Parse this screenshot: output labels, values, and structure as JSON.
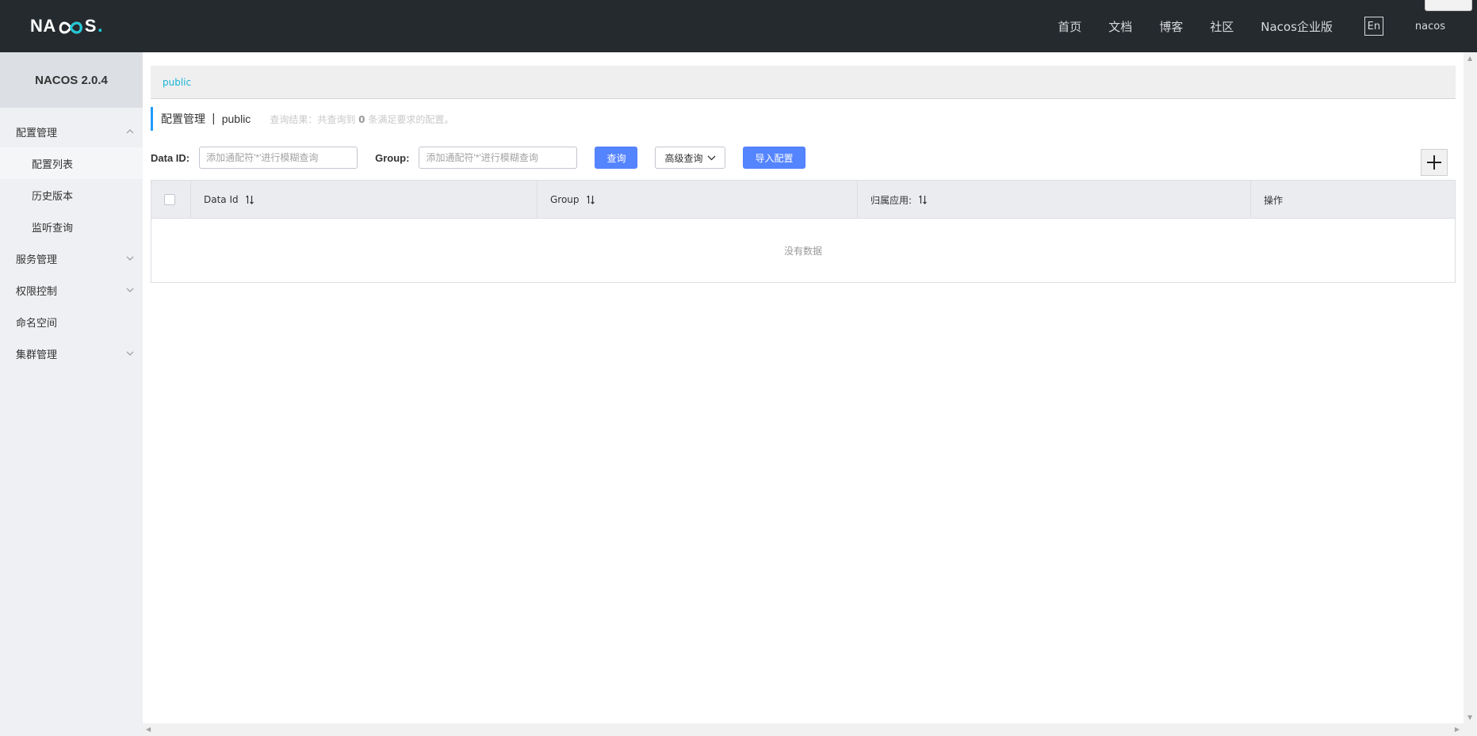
{
  "header": {
    "logo_text_left": "NA",
    "logo_text_right": "S",
    "logo_dot": ".",
    "nav": [
      "首页",
      "文档",
      "博客",
      "社区",
      "Nacos企业版"
    ],
    "lang_label": "En",
    "user": "nacos"
  },
  "sidebar": {
    "version": "NACOS 2.0.4",
    "items": [
      {
        "label": "配置管理"
      },
      {
        "label": "配置列表"
      },
      {
        "label": "历史版本"
      },
      {
        "label": "监听查询"
      },
      {
        "label": "服务管理"
      },
      {
        "label": "权限控制"
      },
      {
        "label": "命名空间"
      },
      {
        "label": "集群管理"
      }
    ]
  },
  "namespace_bar": {
    "current": "public"
  },
  "title": {
    "main": "配置管理",
    "sep": "|",
    "namespace": "public",
    "result_prefix": "查询结果：共查询到",
    "result_count": "0",
    "result_suffix": "条满足要求的配置。"
  },
  "filters": {
    "data_id_label": "Data ID:",
    "data_id_placeholder": "添加通配符'*'进行模糊查询",
    "group_label": "Group:",
    "group_placeholder": "添加通配符'*'进行模糊查询",
    "query_button": "查询",
    "advanced_button": "高级查询",
    "import_button": "导入配置"
  },
  "table": {
    "columns": [
      "Data Id",
      "Group",
      "归属应用:",
      "操作"
    ],
    "empty_text": "没有数据"
  },
  "colors": {
    "header_bg": "#252a2f",
    "primary": "#5584ff",
    "link": "#1ab3d4",
    "sidebar_bg": "#eef0f3"
  }
}
